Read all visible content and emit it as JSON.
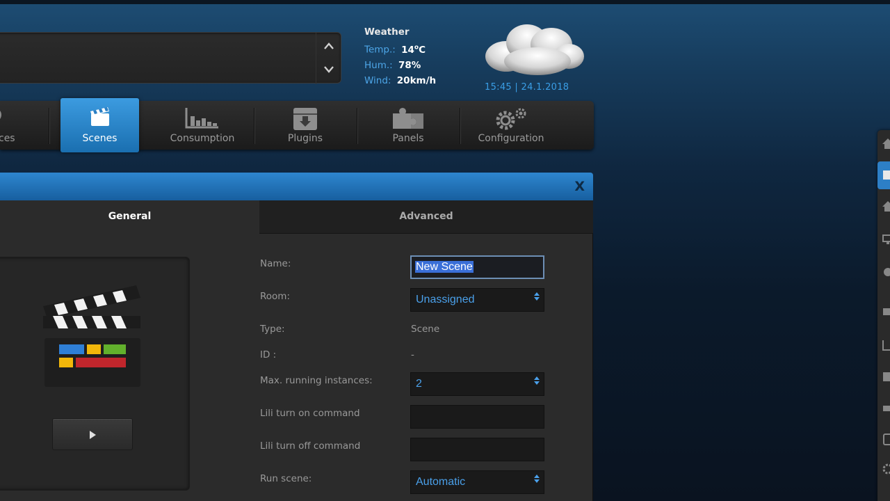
{
  "weather": {
    "title": "Weather",
    "temp_label": "Temp.:",
    "temp_value": "14",
    "temp_unit_sup": "o",
    "temp_unit": "C",
    "hum_label": "Hum.:",
    "hum_value": "78%",
    "wind_label": "Wind:",
    "wind_value": "20km/h",
    "datetime": "15:45 | 24.1.2018"
  },
  "nav": {
    "items": [
      {
        "label": "ces",
        "icon": "bulb-icon"
      },
      {
        "label": "Scenes",
        "icon": "clapperboard-icon",
        "active": true
      },
      {
        "label": "Consumption",
        "icon": "bar-chart-icon"
      },
      {
        "label": "Plugins",
        "icon": "box-download-icon"
      },
      {
        "label": "Panels",
        "icon": "puzzle-icon"
      },
      {
        "label": "Configuration",
        "icon": "gears-icon"
      }
    ]
  },
  "dialog": {
    "close_label": "X",
    "tabs": {
      "general": "General",
      "advanced": "Advanced"
    },
    "fields": {
      "name_label": "Name:",
      "name_value": "New Scene",
      "room_label": "Room:",
      "room_value": "Unassigned",
      "type_label": "Type:",
      "type_value": "Scene",
      "id_label": "ID :",
      "id_value": "-",
      "max_label": "Max. running instances:",
      "max_value": "2",
      "lili_on_label": "Lili turn on command",
      "lili_on_value": "",
      "lili_off_label": "Lili turn off command",
      "lili_off_value": "",
      "run_label": "Run scene:",
      "run_value": "Automatic"
    },
    "play_label": "▶"
  },
  "colors": {
    "accent": "#2e86cf",
    "link_blue": "#4aa0ea",
    "panel_dark": "#2b2b2b"
  }
}
